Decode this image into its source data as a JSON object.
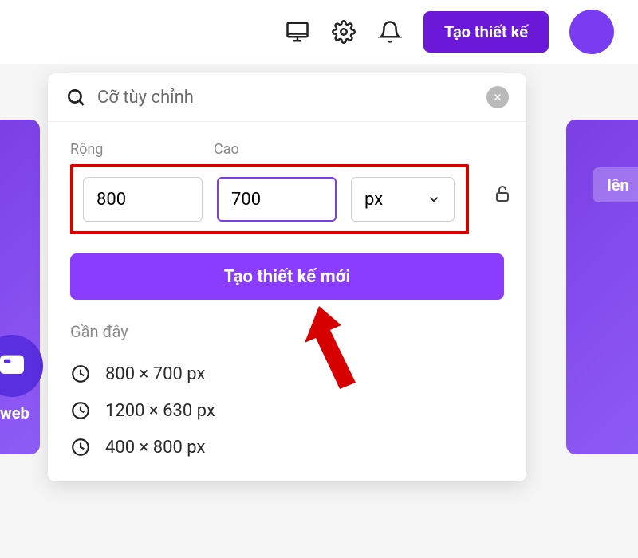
{
  "topbar": {
    "create_label": "Tạo thiết kế"
  },
  "bg": {
    "right_chip": "lên",
    "web_label": "web"
  },
  "popover": {
    "search_value": "Cỡ tùy chỉnh",
    "width_label": "Rộng",
    "height_label": "Cao",
    "width_value": "800",
    "height_value": "700",
    "unit_value": "px",
    "create_new_label": "Tạo thiết kế mới",
    "recent_title": "Gần đây",
    "recent": [
      {
        "label": "800 × 700 px"
      },
      {
        "label": "1200 × 630 px"
      },
      {
        "label": "400 × 800 px"
      }
    ]
  }
}
